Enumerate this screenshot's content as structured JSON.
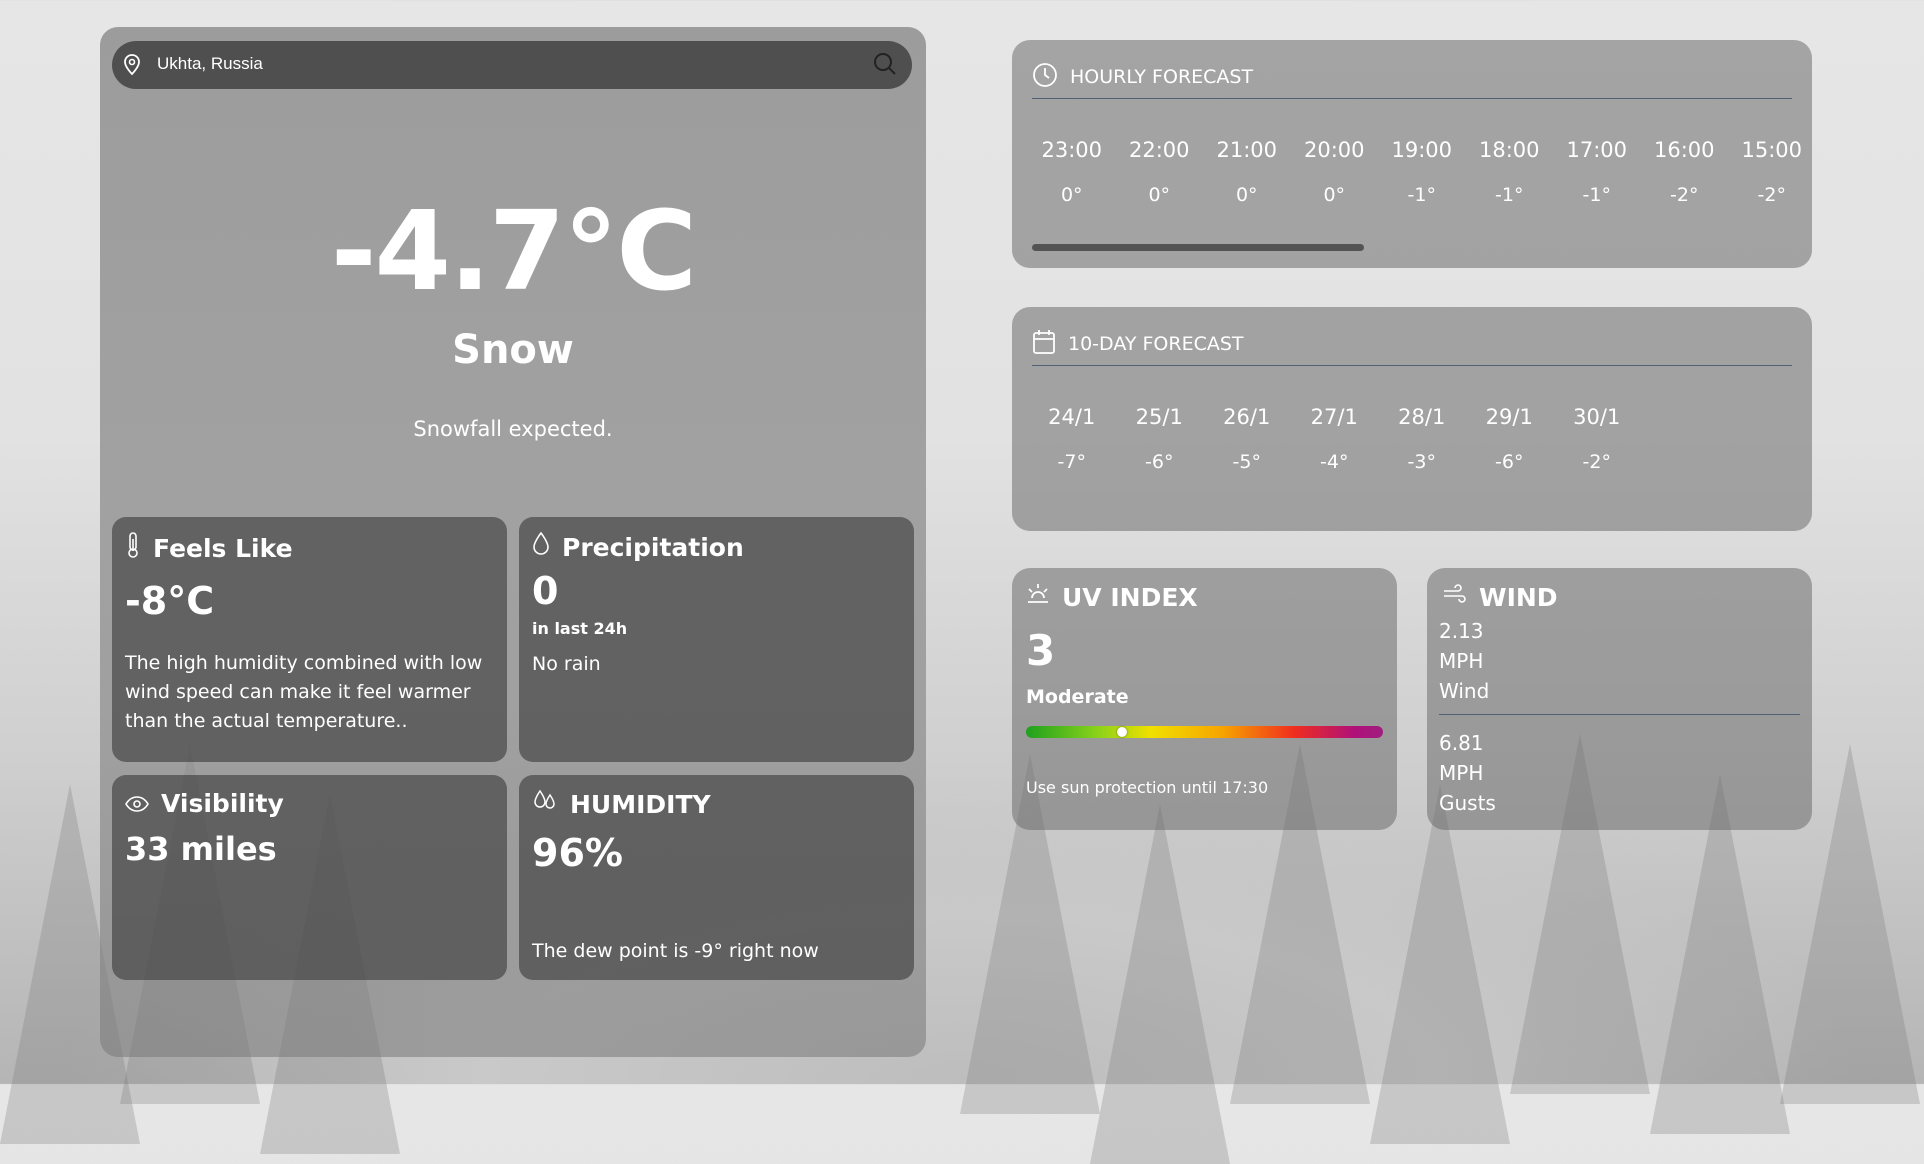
{
  "search": {
    "location": "Ukhta, Russia"
  },
  "current": {
    "temperature": "-4.7°C",
    "condition": "Snow",
    "description": "Snowfall expected."
  },
  "feels_like": {
    "title": "Feels Like",
    "value": "-8°C",
    "note": "The high humidity combined with low wind speed can make it feel warmer than the actual temperature.."
  },
  "precipitation": {
    "title": "Precipitation",
    "value": "0",
    "period": "in last 24h",
    "note": "No rain"
  },
  "visibility": {
    "title": "Visibility",
    "value": "33 miles"
  },
  "humidity": {
    "title": "HUMIDITY",
    "value": "96%",
    "note": "The dew point is -9° right now"
  },
  "hourly": {
    "title": "HOURLY FORECAST",
    "items": [
      {
        "time": "23:00",
        "temp": "0°"
      },
      {
        "time": "22:00",
        "temp": "0°"
      },
      {
        "time": "21:00",
        "temp": "0°"
      },
      {
        "time": "20:00",
        "temp": "0°"
      },
      {
        "time": "19:00",
        "temp": "-1°"
      },
      {
        "time": "18:00",
        "temp": "-1°"
      },
      {
        "time": "17:00",
        "temp": "-1°"
      },
      {
        "time": "16:00",
        "temp": "-2°"
      },
      {
        "time": "15:00",
        "temp": "-2°"
      }
    ]
  },
  "tenday": {
    "title": "10-DAY FORECAST",
    "items": [
      {
        "date": "24/1",
        "temp": "-7°"
      },
      {
        "date": "25/1",
        "temp": "-6°"
      },
      {
        "date": "26/1",
        "temp": "-5°"
      },
      {
        "date": "27/1",
        "temp": "-4°"
      },
      {
        "date": "28/1",
        "temp": "-3°"
      },
      {
        "date": "29/1",
        "temp": "-6°"
      },
      {
        "date": "30/1",
        "temp": "-2°"
      }
    ]
  },
  "uv": {
    "title": "UV INDEX",
    "value": "3",
    "level": "Moderate",
    "scale_position": 0.27,
    "note": "Use sun protection until 17:30"
  },
  "wind": {
    "title": "WIND",
    "speed": "2.13",
    "speed_unit": "MPH",
    "speed_label": "Wind",
    "gust": "6.81",
    "gust_unit": "MPH",
    "gust_label": "Gusts"
  },
  "colors": {
    "uv_gradient": [
      "#1ea01e",
      "#8ad21a",
      "#f0e000",
      "#f7a400",
      "#f02e1e",
      "#b0107a"
    ]
  }
}
